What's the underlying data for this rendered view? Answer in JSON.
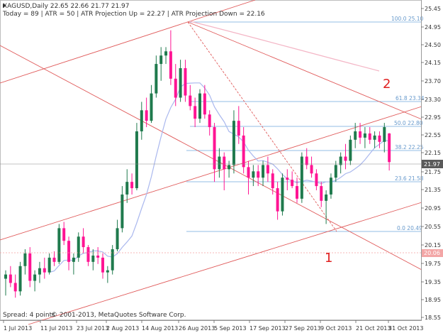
{
  "header": {
    "line1": "XAGUSD,Daily  22.65 22.66 21.77 21.97",
    "line2": "Today = 89  |  ATR = 50  |  ATR Projection Up = 22.27  |  ATR Projection Down = 22.16"
  },
  "footer": {
    "spread": "Spread: 4 points",
    "copyright": "© 2001-2013, MetaQuotes Software Corp."
  },
  "markers": {
    "one": "1",
    "two": "2"
  },
  "colors": {
    "bull": "#1f7a4d",
    "bear": "#ff1493",
    "ma": "#aab8ee",
    "trend": "#e05a5a",
    "fib": "#6fa8dc",
    "upper_band": "#f4b6c6",
    "current_price_box": "#5a5a5a",
    "lower_price_box": "#f3a6a6"
  },
  "price_axis": {
    "labels": [
      "25.45",
      "24.95",
      "24.50",
      "24.15",
      "23.70",
      "23.30",
      "22.95",
      "22.55",
      "22.15",
      "21.75",
      "21.35",
      "20.95",
      "20.55",
      "20.15",
      "19.75",
      "19.35",
      "18.95",
      "18.55"
    ],
    "current_price": "21.97",
    "lower_marker": "20.06"
  },
  "time_axis": {
    "labels": [
      "1 Jul 2013",
      "11 Jul 2013",
      "23 Jul 2013",
      "2 Aug 2013",
      "14 Aug 2013",
      "26 Aug 2013",
      "5 Sep 2013",
      "17 Sep 2013",
      "27 Sep 2013",
      "9 Oct 2013",
      "21 Oct 2013",
      "31 Oct 2013"
    ]
  },
  "fib_levels": [
    {
      "label": "100.0  25.10"
    },
    {
      "label": "61.8  23.34"
    },
    {
      "label": "50.0  22.80"
    },
    {
      "label": "38.2  22.25"
    },
    {
      "label": "23.6  21.58"
    },
    {
      "label": "0.0  20.49"
    }
  ],
  "chart_data": {
    "type": "candlestick",
    "instrument": "XAGUSD",
    "timeframe": "Daily",
    "ylim": [
      18.4,
      25.65
    ],
    "candles": [
      [
        19.2,
        19.4,
        18.8,
        19.3
      ],
      [
        19.3,
        19.5,
        19.0,
        19.1
      ],
      [
        19.1,
        19.3,
        18.75,
        18.9
      ],
      [
        18.9,
        19.6,
        18.8,
        19.5
      ],
      [
        19.5,
        19.9,
        19.3,
        19.8
      ],
      [
        19.8,
        19.95,
        19.0,
        19.15
      ],
      [
        19.15,
        19.4,
        18.9,
        19.3
      ],
      [
        19.3,
        19.6,
        19.1,
        19.45
      ],
      [
        19.45,
        19.7,
        19.2,
        19.35
      ],
      [
        19.35,
        19.8,
        19.3,
        19.7
      ],
      [
        19.7,
        19.85,
        19.5,
        19.6
      ],
      [
        19.6,
        20.5,
        19.55,
        20.4
      ],
      [
        20.4,
        20.55,
        20.0,
        20.1
      ],
      [
        20.1,
        20.2,
        19.4,
        19.6
      ],
      [
        19.6,
        19.8,
        19.3,
        19.7
      ],
      [
        19.7,
        20.3,
        19.6,
        20.2
      ],
      [
        20.2,
        20.4,
        19.8,
        19.95
      ],
      [
        19.95,
        20.0,
        19.5,
        19.6
      ],
      [
        19.6,
        19.9,
        19.4,
        19.75
      ],
      [
        19.75,
        19.95,
        19.55,
        19.7
      ],
      [
        19.7,
        19.8,
        19.2,
        19.35
      ],
      [
        19.35,
        19.5,
        19.1,
        19.4
      ],
      [
        19.4,
        20.0,
        19.3,
        19.9
      ],
      [
        19.9,
        20.6,
        19.85,
        20.4
      ],
      [
        20.4,
        21.4,
        20.3,
        21.2
      ],
      [
        21.2,
        21.8,
        21.0,
        21.5
      ],
      [
        21.5,
        21.7,
        21.2,
        21.35
      ],
      [
        21.35,
        22.9,
        21.3,
        22.7
      ],
      [
        22.7,
        23.4,
        22.5,
        23.2
      ],
      [
        23.2,
        23.5,
        22.8,
        22.95
      ],
      [
        22.95,
        23.8,
        22.9,
        23.6
      ],
      [
        23.6,
        24.5,
        23.5,
        24.3
      ],
      [
        24.3,
        24.7,
        23.9,
        24.5
      ],
      [
        24.5,
        24.7,
        24.3,
        24.6
      ],
      [
        24.6,
        25.1,
        23.8,
        23.95
      ],
      [
        23.95,
        24.3,
        23.3,
        23.5
      ],
      [
        23.5,
        24.4,
        23.4,
        24.2
      ],
      [
        24.2,
        24.4,
        23.4,
        23.55
      ],
      [
        23.55,
        23.8,
        23.2,
        23.3
      ],
      [
        23.3,
        23.5,
        22.8,
        23.0
      ],
      [
        23.0,
        23.7,
        22.9,
        23.6
      ],
      [
        23.6,
        23.8,
        23.0,
        23.1
      ],
      [
        23.1,
        23.2,
        22.6,
        22.8
      ],
      [
        22.8,
        22.9,
        21.5,
        21.8
      ],
      [
        21.8,
        22.3,
        21.6,
        22.1
      ],
      [
        22.1,
        22.2,
        21.3,
        21.8
      ],
      [
        21.8,
        22.0,
        21.6,
        21.9
      ],
      [
        21.9,
        23.2,
        21.7,
        22.95
      ],
      [
        22.95,
        23.3,
        22.4,
        22.6
      ],
      [
        22.6,
        22.8,
        21.7,
        21.85
      ],
      [
        21.85,
        22.0,
        21.2,
        21.6
      ],
      [
        21.6,
        21.9,
        21.4,
        21.75
      ],
      [
        21.75,
        21.9,
        21.4,
        21.6
      ],
      [
        21.6,
        22.0,
        21.4,
        21.9
      ],
      [
        21.9,
        22.1,
        21.5,
        21.7
      ],
      [
        21.7,
        21.8,
        21.2,
        21.35
      ],
      [
        21.35,
        21.5,
        20.6,
        20.8
      ],
      [
        20.8,
        21.7,
        20.7,
        21.6
      ],
      [
        21.6,
        21.8,
        21.3,
        21.55
      ],
      [
        21.55,
        21.75,
        21.35,
        21.4
      ],
      [
        21.4,
        21.6,
        21.0,
        21.1
      ],
      [
        21.1,
        22.2,
        21.0,
        22.1
      ],
      [
        22.1,
        22.3,
        21.8,
        21.9
      ],
      [
        21.9,
        22.1,
        21.6,
        21.7
      ],
      [
        21.7,
        21.8,
        21.3,
        21.4
      ],
      [
        21.4,
        21.5,
        20.9,
        21.05
      ],
      [
        21.05,
        21.3,
        20.5,
        21.2
      ],
      [
        21.2,
        21.7,
        21.1,
        21.6
      ],
      [
        21.6,
        22.0,
        21.5,
        21.9
      ],
      [
        21.9,
        22.2,
        21.7,
        22.1
      ],
      [
        22.1,
        22.4,
        21.8,
        22.0
      ],
      [
        22.0,
        22.6,
        21.9,
        22.5
      ],
      [
        22.5,
        22.9,
        22.3,
        22.7
      ],
      [
        22.7,
        22.9,
        22.4,
        22.55
      ],
      [
        22.55,
        22.8,
        22.3,
        22.65
      ],
      [
        22.65,
        22.8,
        22.4,
        22.5
      ],
      [
        22.5,
        22.7,
        22.3,
        22.6
      ],
      [
        22.6,
        22.7,
        22.3,
        22.45
      ],
      [
        22.45,
        22.9,
        22.2,
        22.8
      ],
      [
        22.65,
        22.66,
        21.77,
        21.97
      ]
    ]
  }
}
